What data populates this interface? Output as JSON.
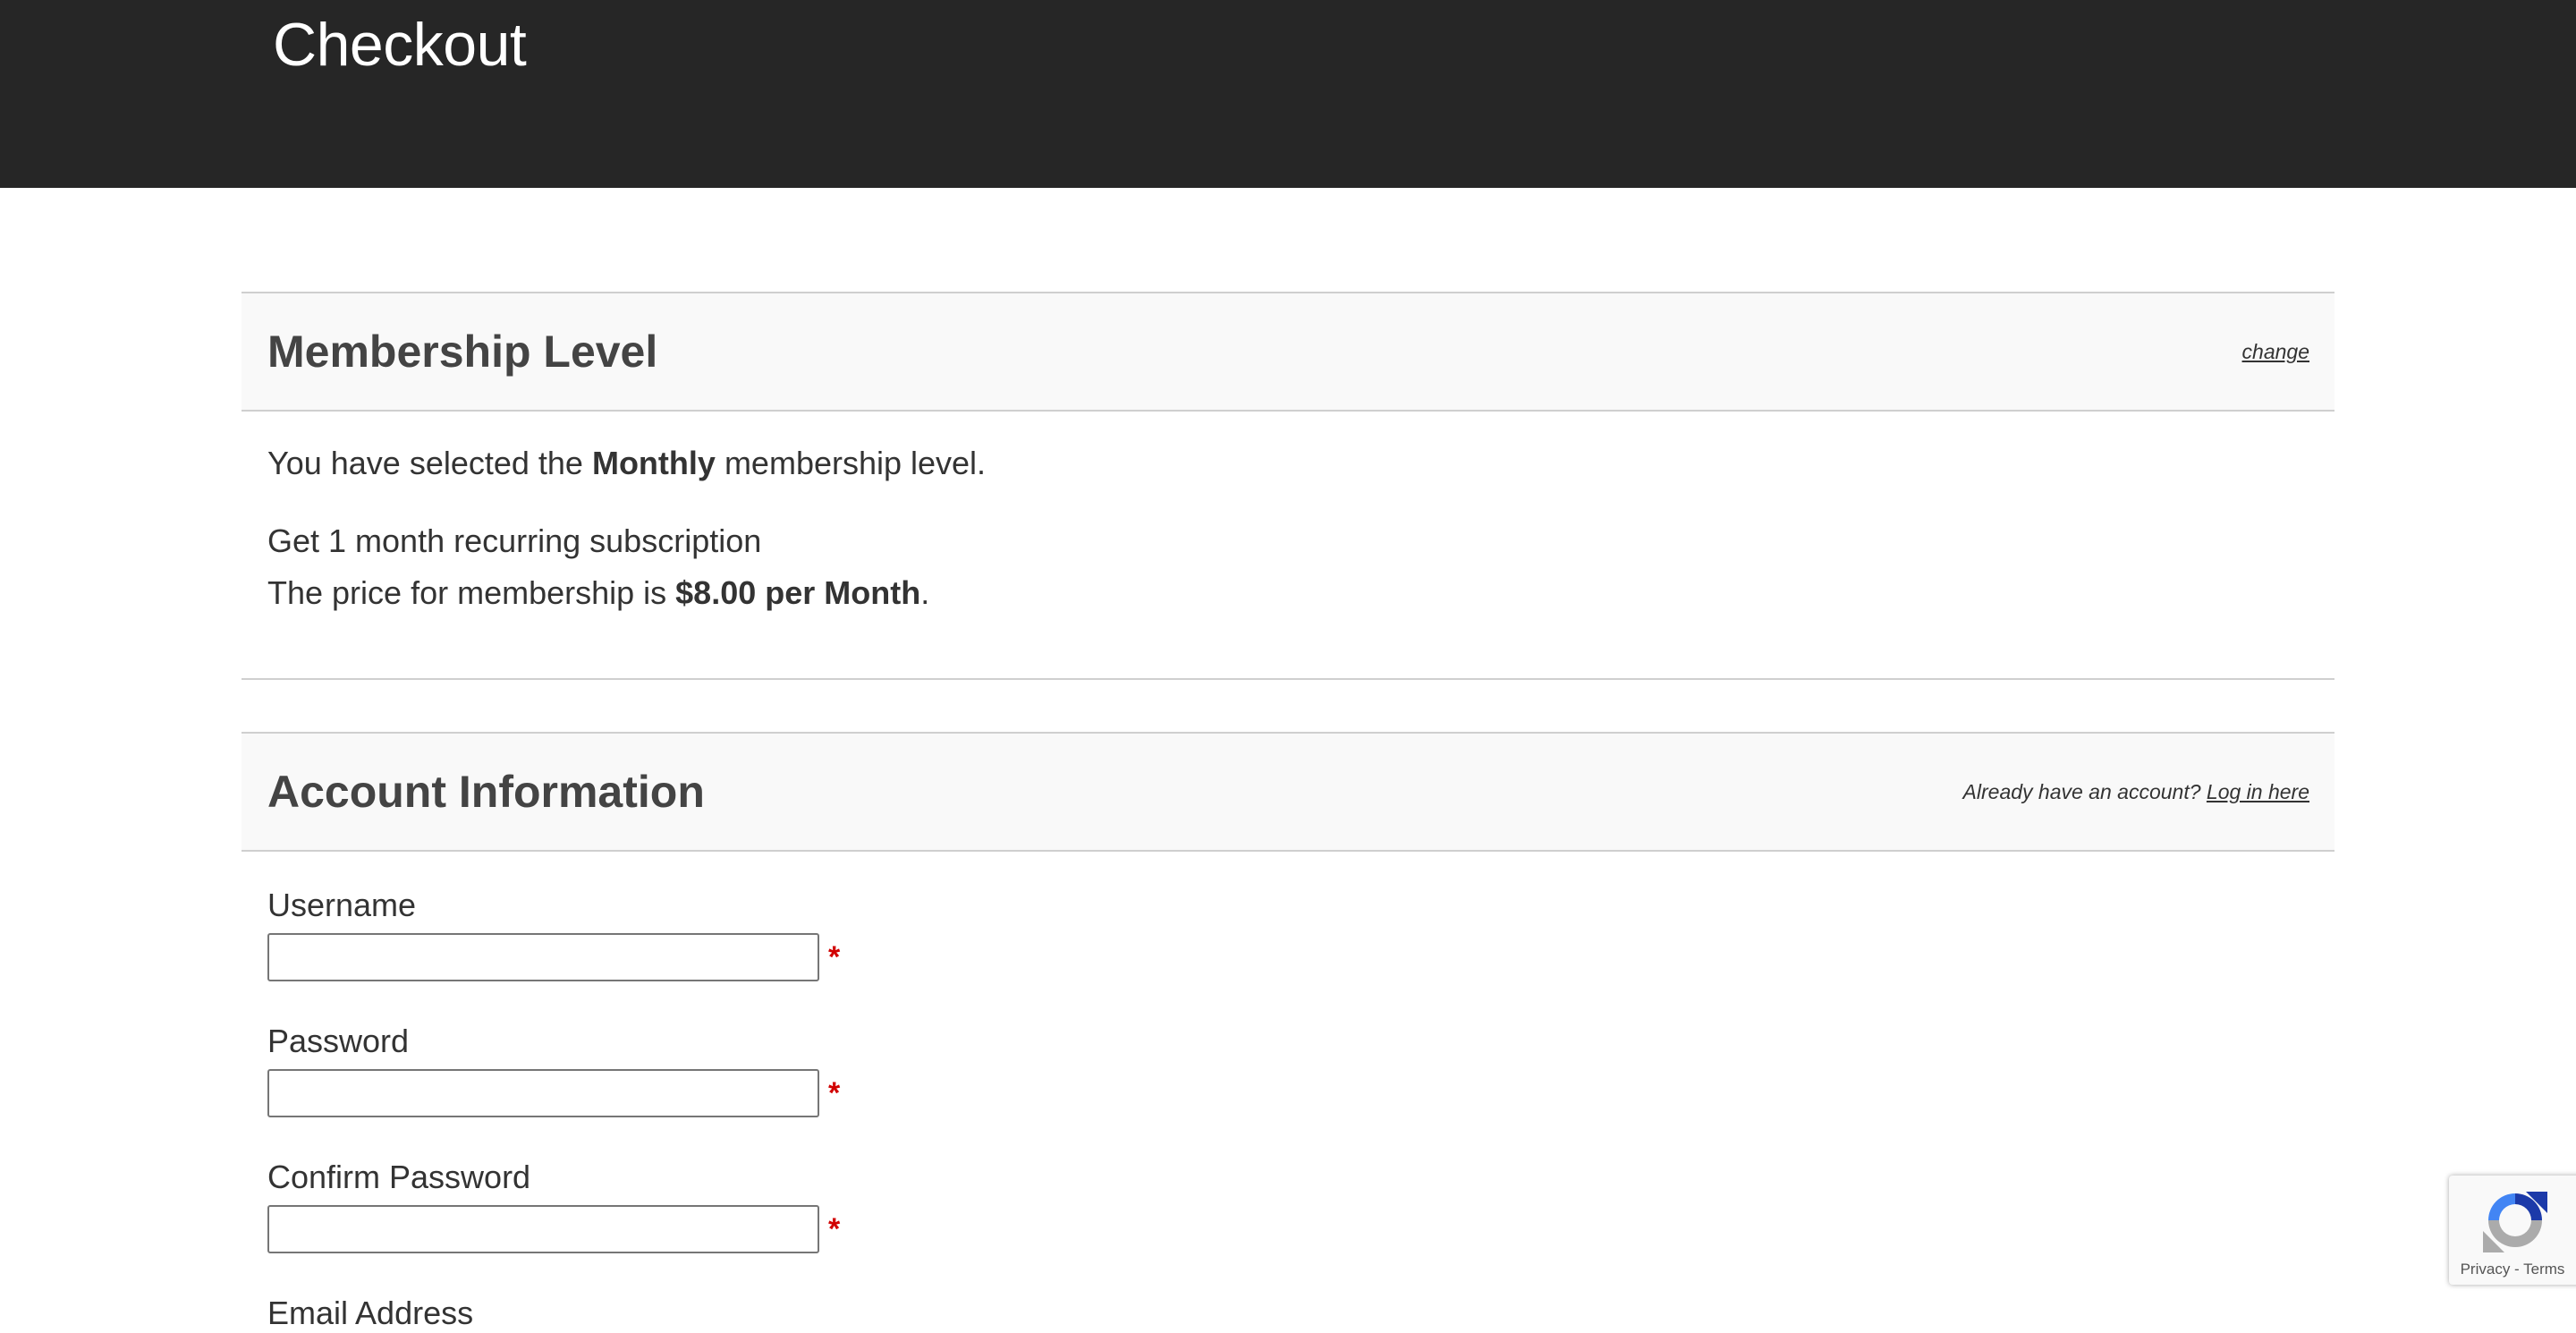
{
  "page": {
    "title": "Checkout"
  },
  "membership": {
    "heading": "Membership Level",
    "change_link": "change",
    "selected_prefix": "You have selected the ",
    "selected_level": "Monthly",
    "selected_suffix": " membership level.",
    "description": "Get 1 month recurring subscription",
    "price_prefix": "The price for membership is ",
    "price": "$8.00 per Month",
    "price_suffix": "."
  },
  "account": {
    "heading": "Account Information",
    "login_prompt": "Already have an account? ",
    "login_link": "Log in here",
    "fields": [
      {
        "label": "Username",
        "value": "",
        "required_marker": "*"
      },
      {
        "label": "Password",
        "value": "",
        "required_marker": "*"
      },
      {
        "label": "Confirm Password",
        "value": "",
        "required_marker": "*"
      },
      {
        "label": "Email Address"
      }
    ]
  },
  "recaptcha": {
    "links": "Privacy - Terms"
  },
  "colors": {
    "header_bg": "#262626",
    "section_bg": "#f9f9f9",
    "required": "#d10000",
    "border": "#cfcfcf"
  }
}
